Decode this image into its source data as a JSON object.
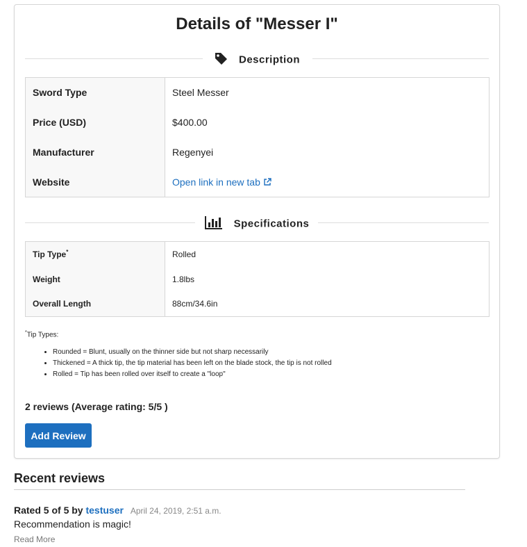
{
  "page_title": "Details of \"Messer I\"",
  "description": {
    "heading": "Description",
    "rows": [
      {
        "key": "Sword Type",
        "value": "Steel Messer"
      },
      {
        "key": "Price (USD)",
        "value": "$400.00"
      },
      {
        "key": "Manufacturer",
        "value": "Regenyei"
      }
    ],
    "website_key": "Website",
    "website_link": "Open link in new tab"
  },
  "specifications": {
    "heading": "Specifications",
    "tip_type_key": "Tip Type",
    "tip_type_mark": "*",
    "tip_type_value": "Rolled",
    "rows": [
      {
        "key": "Weight",
        "value": "1.8lbs"
      },
      {
        "key": "Overall Length",
        "value": "88cm/34.6in"
      }
    ]
  },
  "tip_note": {
    "mark": "*",
    "title": "Tip Types:",
    "items": [
      "Rounded = Blunt, usually on the thinner side but not sharp necessarily",
      "Thickened = A thick tip, the tip material has been left on the blade stock, the tip is not rolled",
      "Rolled = Tip has been rolled over itself to create a \"loop\""
    ]
  },
  "reviews_summary": "2 reviews (Average rating: 5/5 )",
  "add_review_label": "Add Review",
  "recent_reviews": {
    "title": "Recent reviews",
    "items": [
      {
        "rating_text": "Rated 5 of 5 by",
        "user": "testuser",
        "date": "April 24, 2019, 2:51 a.m.",
        "body": "Recommendation is magic!",
        "read_more": "Read More"
      }
    ]
  },
  "colors": {
    "accent": "#1d6fbf",
    "button_text": "#ffffff"
  }
}
